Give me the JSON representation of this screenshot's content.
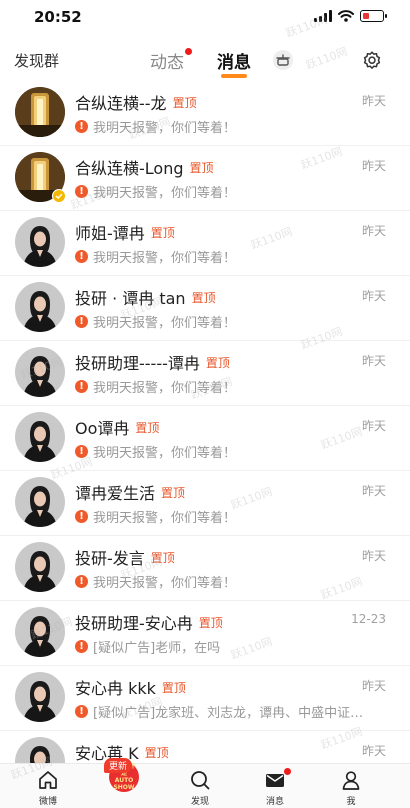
{
  "status_bar": {
    "time": "20:52"
  },
  "top_nav": {
    "left_label": "发现群",
    "tabs": [
      {
        "label": "动态",
        "active": false,
        "has_dot": true
      },
      {
        "label": "消息",
        "active": true,
        "has_dot": false
      }
    ],
    "settings_icon": "gear-icon",
    "compose_icon": "pot-icon"
  },
  "chats": [
    {
      "name": "合纵连横--龙",
      "pin": "置顶",
      "time": "昨天",
      "preview": "我明天报警，你们等着！",
      "avatar": "gold",
      "verified": false
    },
    {
      "name": "合纵连横-Long",
      "pin": "置顶",
      "time": "昨天",
      "preview": "我明天报警，你们等着！",
      "avatar": "gold",
      "verified": true
    },
    {
      "name": "师姐-谭冉",
      "pin": "置顶",
      "time": "昨天",
      "preview": "我明天报警，你们等着！",
      "avatar": "woman",
      "verified": false
    },
    {
      "name": "投研 · 谭冉 tan",
      "pin": "置顶",
      "time": "昨天",
      "preview": "我明天报警，你们等着！",
      "avatar": "woman",
      "verified": false
    },
    {
      "name": "投研助理-----谭冉",
      "pin": "置顶",
      "time": "昨天",
      "preview": "我明天报警，你们等着！",
      "avatar": "woman",
      "verified": false
    },
    {
      "name": "Oo谭冉",
      "pin": "置顶",
      "time": "昨天",
      "preview": "我明天报警，你们等着！",
      "avatar": "woman",
      "verified": false
    },
    {
      "name": "谭冉爱生活",
      "pin": "置顶",
      "time": "昨天",
      "preview": "我明天报警，你们等着！",
      "avatar": "woman",
      "verified": false
    },
    {
      "name": "投研-发言",
      "pin": "置顶",
      "time": "昨天",
      "preview": "我明天报警，你们等着！",
      "avatar": "woman",
      "verified": false
    },
    {
      "name": "投研助理-安心冉",
      "pin": "置顶",
      "time": "12-23",
      "preview": "[疑似广告]老师，在吗",
      "avatar": "woman",
      "verified": false
    },
    {
      "name": "安心冉 kkk",
      "pin": "置顶",
      "time": "昨天",
      "preview": "[疑似广告]龙家班、刘志龙，谭冉、中盛中证…",
      "avatar": "woman",
      "verified": false
    },
    {
      "name": "安心苒 K",
      "pin": "置顶",
      "time": "昨天",
      "preview": "",
      "avatar": "woman",
      "verified": false
    }
  ],
  "watermark_text": "跃110网",
  "bottom_tabs": [
    {
      "label": "微博",
      "icon": "home-icon"
    },
    {
      "label": "",
      "icon": "promo-icon",
      "badge": "更新",
      "promo_text": "我们可不是 AUTO SHOW"
    },
    {
      "label": "发现",
      "icon": "search-icon"
    },
    {
      "label": "消息",
      "icon": "mail-icon",
      "has_dot": true
    },
    {
      "label": "我",
      "icon": "user-icon"
    }
  ],
  "colors": {
    "accent_orange": "#ff8a1c",
    "pin_red": "#e8562a",
    "alert_red": "#f05a2a",
    "dot_red": "#f01a1a"
  }
}
